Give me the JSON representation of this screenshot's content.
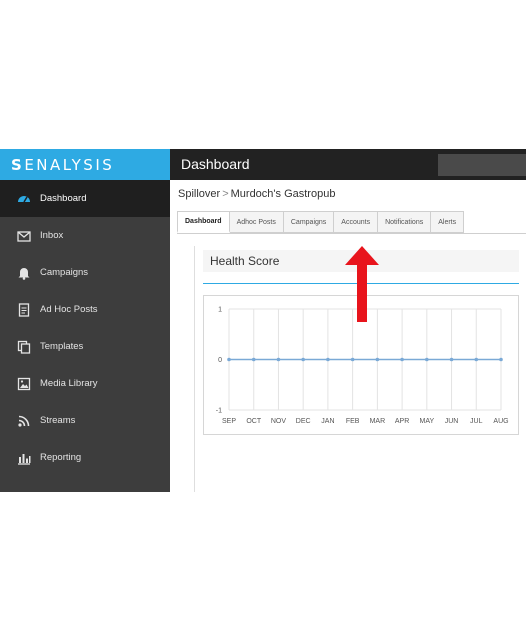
{
  "app": {
    "logo_initial": "S",
    "logo_rest": "ENALYSIS"
  },
  "header": {
    "title": "Dashboard"
  },
  "sidebar": {
    "items": [
      {
        "label": "Dashboard",
        "icon": "speedometer-icon",
        "active": true
      },
      {
        "label": "Inbox",
        "icon": "envelope-icon"
      },
      {
        "label": "Campaigns",
        "icon": "bell-icon"
      },
      {
        "label": "Ad Hoc Posts",
        "icon": "document-icon"
      },
      {
        "label": "Templates",
        "icon": "copy-icon"
      },
      {
        "label": "Media Library",
        "icon": "image-icon"
      },
      {
        "label": "Streams",
        "icon": "rss-icon"
      },
      {
        "label": "Reporting",
        "icon": "bar-chart-icon"
      }
    ]
  },
  "breadcrumb": {
    "parent": "Spillover",
    "separator": ">",
    "current": "Murdoch's Gastropub"
  },
  "tabs": [
    {
      "label": "Dashboard",
      "active": true
    },
    {
      "label": "Adhoc Posts"
    },
    {
      "label": "Campaigns"
    },
    {
      "label": "Accounts"
    },
    {
      "label": "Notifications"
    },
    {
      "label": "Alerts"
    }
  ],
  "panel": {
    "title": "Health Score"
  },
  "colors": {
    "accent": "#2eaae3",
    "annotation": "#e8141c",
    "sidebar_bg": "#3d3d3d",
    "series_line": "#7aa9d6"
  },
  "chart_data": {
    "type": "line",
    "categories": [
      "SEP",
      "OCT",
      "NOV",
      "DEC",
      "JAN",
      "FEB",
      "MAR",
      "APR",
      "MAY",
      "JUN",
      "JUL",
      "AUG"
    ],
    "series": [
      {
        "values": [
          0,
          0,
          0,
          0,
          0,
          0,
          0,
          0,
          0,
          0,
          0,
          0
        ]
      }
    ],
    "ylim": [
      -1,
      1
    ],
    "yticks": [
      "1",
      "0",
      "-1"
    ],
    "grid": true
  }
}
